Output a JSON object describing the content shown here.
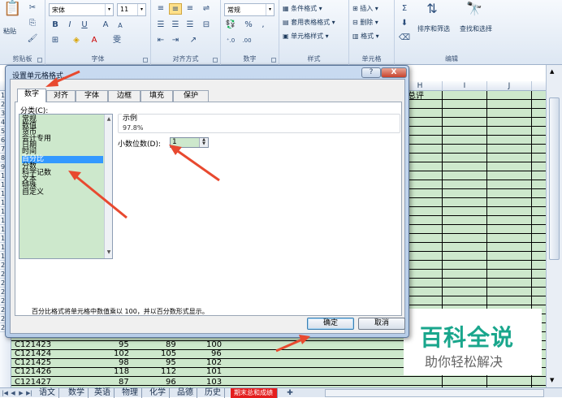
{
  "ribbon": {
    "clipboard": {
      "paste_label": "粘贴",
      "group_label": "剪贴板"
    },
    "font": {
      "font_name": "宋体",
      "font_size": "11",
      "group_label": "字体",
      "bold": "B",
      "italic": "I",
      "underline": "U",
      "grow": "A",
      "shrink": "A",
      "wen": "雯"
    },
    "alignment": {
      "group_label": "对齐方式"
    },
    "number": {
      "format": "常规",
      "percent": "%",
      "comma": ",",
      "group_label": "数字"
    },
    "styles": {
      "conditional": "条件格式",
      "table": "套用表格格式",
      "cell_styles": "单元格样式",
      "group_label": "样式"
    },
    "cells": {
      "insert": "插入",
      "delete": "删除",
      "format": "格式",
      "group_label": "单元格"
    },
    "editing": {
      "sum": "Σ",
      "sort_filter": "排序和筛选",
      "find_select": "查找和选择",
      "group_label": "编辑"
    }
  },
  "sheet": {
    "columns": [
      "H",
      "I",
      "J"
    ],
    "h_header_text": "末总评",
    "row_numbers": [
      "1",
      "2",
      "3",
      "4",
      "5",
      "6",
      "7",
      "8",
      "9",
      "10",
      "11",
      "12",
      "13",
      "14",
      "15",
      "16",
      "17",
      "18",
      "19",
      "20",
      "21",
      "22",
      "23",
      "24",
      "25",
      "26",
      "27"
    ],
    "rows": [
      {
        "id": "C121423",
        "a": "95",
        "b": "89",
        "c": "100"
      },
      {
        "id": "C121424",
        "a": "102",
        "b": "105",
        "c": "96"
      },
      {
        "id": "C121425",
        "a": "98",
        "b": "95",
        "c": "102"
      },
      {
        "id": "C121426",
        "a": "118",
        "b": "112",
        "c": "101"
      },
      {
        "id": "C121427",
        "a": "87",
        "b": "96",
        "c": "103"
      }
    ]
  },
  "sheet_tabs": [
    "语文",
    "数学",
    "英语",
    "物理",
    "化学",
    "品德",
    "历史",
    "期末总和成绩"
  ],
  "dialog": {
    "title": "设置单元格格式",
    "help": "?",
    "close": "X",
    "tabs": [
      "数字",
      "对齐",
      "字体",
      "边框",
      "填充",
      "保护"
    ],
    "category_label": "分类(C):",
    "categories": [
      "常规",
      "数值",
      "货币",
      "会计专用",
      "日期",
      "时间",
      "百分比",
      "分数",
      "科学记数",
      "文本",
      "特殊",
      "自定义"
    ],
    "selected_category": "百分比",
    "sample_label": "示例",
    "sample_value": "97.8%",
    "decimal_label": "小数位数(D):",
    "decimal_value": "1",
    "description": "百分比格式将单元格中数值乘以 100，并以百分数形式显示。",
    "ok": "确定",
    "cancel": "取消"
  },
  "watermark": {
    "line1": "百科全说",
    "line2": "助你轻松解决"
  },
  "colors": {
    "cell_fill": "#cde8cc",
    "dialog_frame": "#b7cde8",
    "arrow": "#e8492f",
    "watermark_green": "#19a68c"
  }
}
